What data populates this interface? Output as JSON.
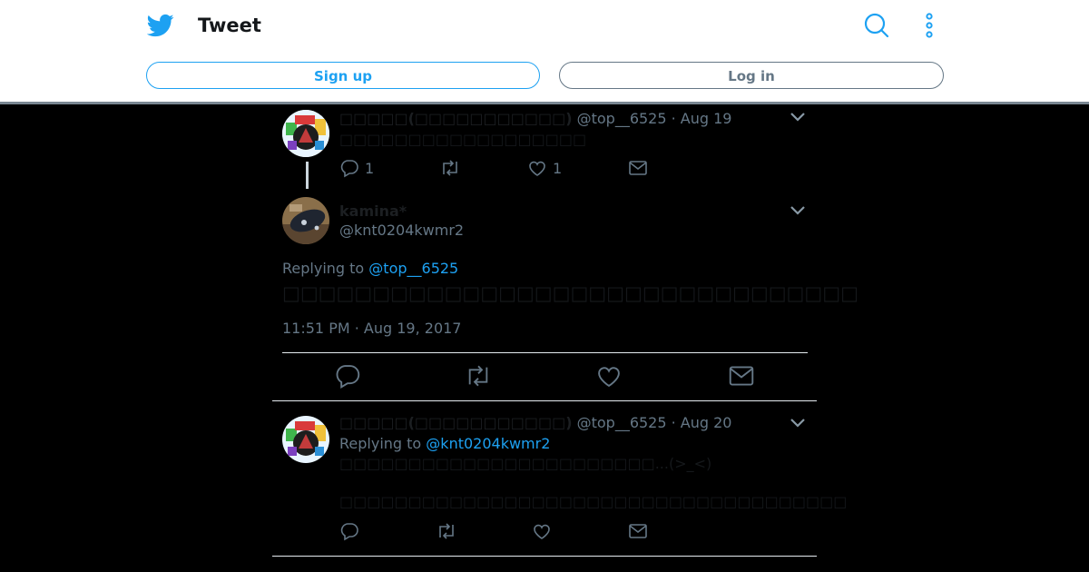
{
  "header": {
    "title": "Tweet",
    "signup_label": "Sign up",
    "login_label": "Log in"
  },
  "icons": {
    "logo": "twitter-bird-icon",
    "search": "search-icon",
    "more": "more-vertical-icon"
  },
  "colors": {
    "accent": "#1da1f2",
    "muted": "#657786",
    "background": "#000000"
  },
  "tweets": [
    {
      "name": "□□□□□(□□□□□□□□□□□)",
      "handle": "@top__6525",
      "date": "· Aug 19",
      "text": "□□□□□□□□□□□□□□□□□□",
      "reply_count": "1",
      "like_count": "1"
    }
  ],
  "main_tweet": {
    "name": "kamina*",
    "handle": "@knt0204kwmr2",
    "replying_prefix": "Replying to",
    "replying_to": "@top__6525",
    "text": "□□□□□□□□□□□□□□□□□□□□□□□□□□□□□□□□",
    "timestamp": "11:51 PM · Aug 19, 2017"
  },
  "reply": {
    "name": "□□□□□(□□□□□□□□□□□)",
    "handle": "@top__6525",
    "date": "· Aug 20",
    "replying_prefix": "Replying to",
    "replying_to": "@knt0204kwmr2",
    "text_line1": "□□□□□□□□□□□□□□□□□□□□□□□...(>_<)",
    "text_line2": "□□□□□□□□□□□□□□□□□□□□□□□□□□□□□□□□□□□□□"
  }
}
